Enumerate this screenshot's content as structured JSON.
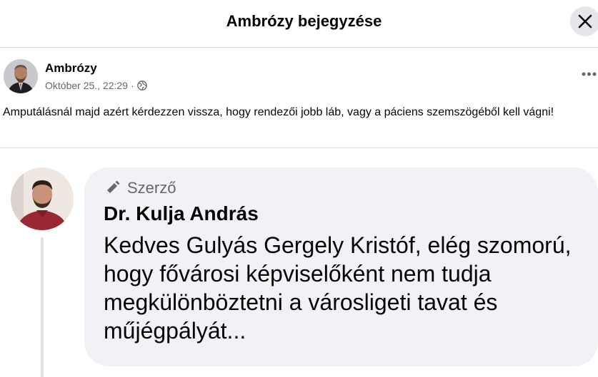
{
  "dialog": {
    "title": "Ambrózy bejegyzése",
    "close_icon": "close-icon"
  },
  "post": {
    "author": "Ambrózy",
    "date": "Október 25., 22:29",
    "separator": "·",
    "privacy_icon": "globe-icon",
    "more_icon": "more-horizontal-icon",
    "text": "Amputálásnál majd azért kérdezzen vissza, hogy rendezői jobb láb, vagy a páciens szemszögéből kell vágni!"
  },
  "comment": {
    "badge_icon": "pencil-icon",
    "badge_label": "Szerző",
    "author": "Dr. Kulja András",
    "text": "Kedves Gulyás Gergely Kristóf, elég szomorú, hogy fővárosi képviselőként nem tudja megkülönböztetni a városligeti tavat és műjégpályát..."
  },
  "colors": {
    "primary_text": "#050505",
    "secondary_text": "#65676b",
    "bubble_bg": "#f0f2f5",
    "divider": "#dadde1"
  }
}
